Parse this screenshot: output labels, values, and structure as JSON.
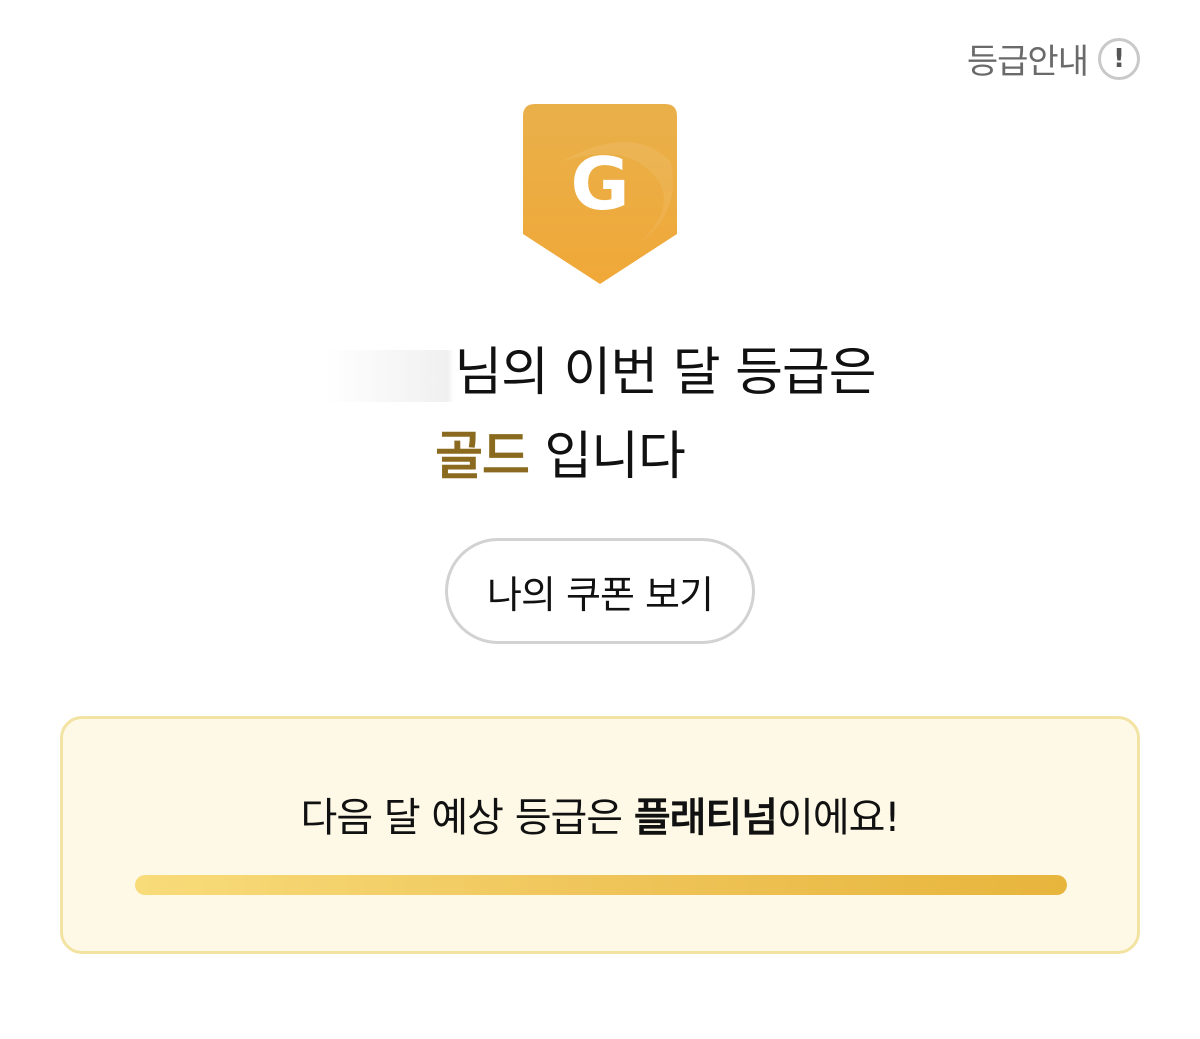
{
  "header": {
    "grade_guide_label": "등급안내",
    "info_icon_glyph": "!",
    "info_icon_name": "info-icon"
  },
  "badge": {
    "letter": "G",
    "color_top": "#e9b04a",
    "color_bottom": "#f0a838",
    "icon_name": "grade-badge-icon"
  },
  "headline": {
    "line1_suffix": "님의 이번 달 등급은",
    "grade_name": "골드",
    "line2_suffix": " 입니다",
    "grade_color": "#8a6a1e"
  },
  "coupon_button": {
    "label": "나의 쿠폰 보기"
  },
  "next_grade": {
    "prefix": "다음 달 예상 등급은 ",
    "grade_name": "플래티넘",
    "suffix": "이에요!",
    "progress_percent": 100,
    "box_bg": "#fdf9e6",
    "box_border": "#f3e3a2"
  }
}
